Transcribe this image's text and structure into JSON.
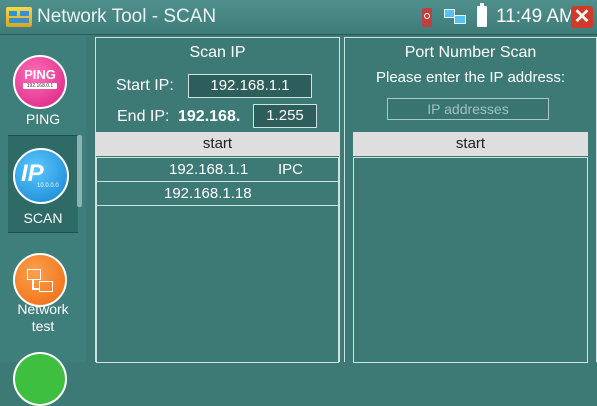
{
  "window": {
    "title": "Network Tool - SCAN",
    "clock": "11:49 AM",
    "close_glyph": "✕"
  },
  "sidebar": {
    "items": [
      {
        "label": "PING",
        "icon": "ping-icon",
        "icon_text": "PING",
        "icon_subtext": "192.168.0.1"
      },
      {
        "label": "SCAN",
        "icon": "ip-scan-icon",
        "icon_text": "IP",
        "icon_subtext": "10.0.0.0",
        "active": true
      },
      {
        "label_line1": "Network",
        "label_line2": "test",
        "icon": "network-test-icon"
      }
    ]
  },
  "scan_ip": {
    "title": "Scan IP",
    "start_label": "Start IP:",
    "start_value": "192.168.1.1",
    "end_label": "End IP:",
    "end_prefix": "192.168.",
    "end_value": "1.255",
    "start_button": "start",
    "results": [
      {
        "ip": "192.168.1.1",
        "type": "IPC"
      },
      {
        "ip": "192.168.1.18",
        "type": ""
      }
    ]
  },
  "port_scan": {
    "title": "Port Number Scan",
    "prompt": "Please enter the IP address:",
    "ip_placeholder": "IP addresses",
    "start_button": "start"
  },
  "colors": {
    "background": "#3d7a76",
    "accent_blue": "#1e9ae0",
    "accent_pink": "#e8389a",
    "accent_orange": "#f5781f",
    "close_red": "#d03a2a"
  }
}
